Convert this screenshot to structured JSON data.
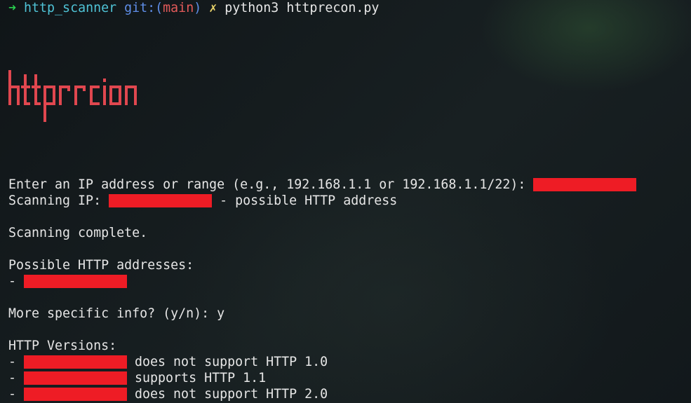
{
  "prompt": {
    "arrow": "➜",
    "directory": "http_scanner",
    "git_label": "git:",
    "paren_open": "(",
    "branch": "main",
    "paren_close": ")",
    "dirty_mark": "✗",
    "command": "python3 httprecon.py"
  },
  "banner": {
    "text": "httprecon",
    "color": "#e0474f"
  },
  "output": {
    "ip_prompt": "Enter an IP address or range (e.g., 192.168.1.1 or 192.168.1.1/22): ",
    "scanning_label": "Scanning IP: ",
    "scanning_suffix": " - possible HTTP address",
    "scan_complete": "Scanning complete.",
    "addresses_header": "Possible HTTP addresses:",
    "dash": "- ",
    "more_info_prompt": "More specific info? (y/n): ",
    "more_info_answer": "y",
    "versions_header": "HTTP Versions:",
    "versions": [
      {
        "suffix": " does not support HTTP 1.0"
      },
      {
        "suffix": " supports HTTP 1.1"
      },
      {
        "suffix": " does not support HTTP 2.0"
      }
    ]
  },
  "colors": {
    "redaction": "#ee1c25",
    "arrow": "#2ad14f",
    "directory": "#4fc3d6",
    "git": "#5f8ee8",
    "branch": "#e25a5a",
    "dirty": "#e8d36a"
  }
}
